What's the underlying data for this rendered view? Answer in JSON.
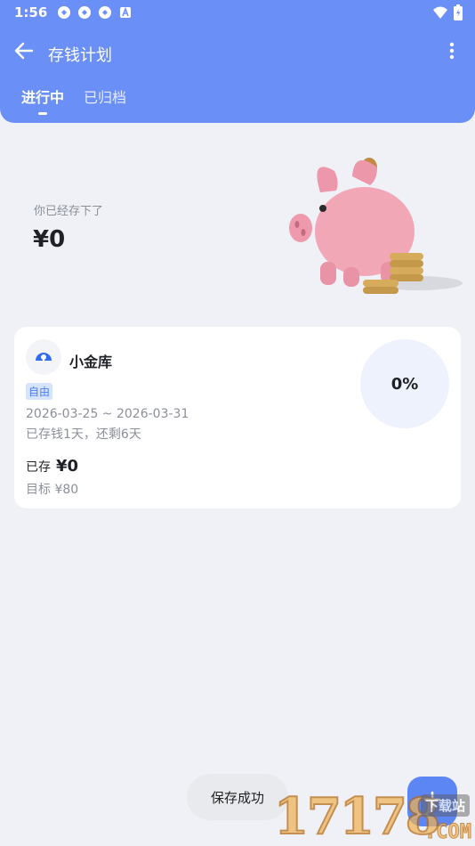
{
  "statusbar": {
    "time": "1:56",
    "icons": [
      "sync-icon",
      "sync-icon",
      "sync-icon",
      "a-icon"
    ],
    "right_icons": [
      "wifi-icon",
      "battery-icon"
    ]
  },
  "appbar": {
    "title": "存钱计划",
    "back_icon": "arrow-left-icon",
    "more_icon": "more-vert-icon"
  },
  "tabs": [
    {
      "label": "进行中",
      "active": true
    },
    {
      "label": "已归档",
      "active": false
    }
  ],
  "hero": {
    "saved_label": "你已经存下了",
    "saved_amount": "¥0",
    "image": "piggy-bank-illustration"
  },
  "plans": [
    {
      "name": "小金库",
      "tag": "自由",
      "date_range": "2026-03-25 ~ 2026-03-31",
      "progress_text": "已存钱1天，还剩6天",
      "saved_label": "已存",
      "saved_value": "¥0",
      "target_text": "目标 ¥80",
      "percent": "0%"
    }
  ],
  "toast": "保存成功",
  "fab": {
    "icon": "plus-icon"
  },
  "watermark": {
    "digits": "17178",
    "site": "下载站",
    "domain": ".COM"
  },
  "colors": {
    "primary": "#6a8ff7",
    "background": "#f0f1f6",
    "tag_bg": "#d6e4ff",
    "tag_text": "#4a7cf5",
    "ring_bg": "#eef2fd"
  }
}
